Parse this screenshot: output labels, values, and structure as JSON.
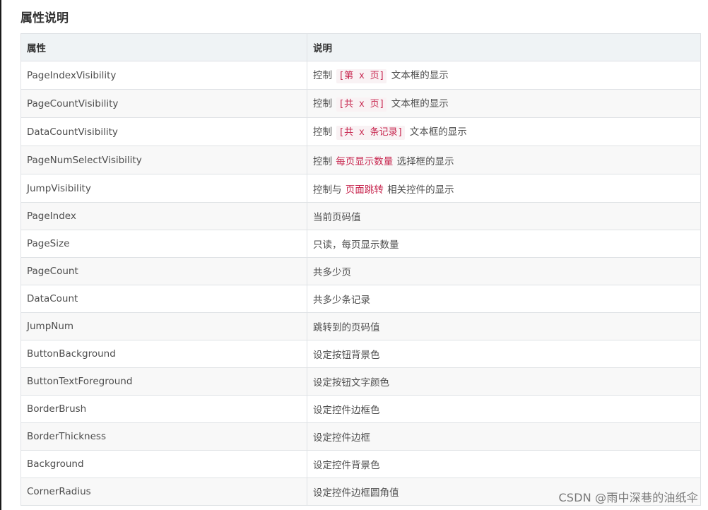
{
  "heading": "属性说明",
  "table": {
    "headers": [
      "属性",
      "说明"
    ],
    "rows": [
      {
        "property": "PageIndexVisibility",
        "pre": "控制 ",
        "code": "[第 x 页]",
        "post": " 文本框的显示",
        "style": "code"
      },
      {
        "property": "PageCountVisibility",
        "pre": "控制 ",
        "code": "[共 x 页]",
        "post": " 文本框的显示",
        "style": "code"
      },
      {
        "property": "DataCountVisibility",
        "pre": "控制 ",
        "code": "[共 x 条记录]",
        "post": " 文本框的显示",
        "style": "code"
      },
      {
        "property": "PageNumSelectVisibility",
        "pre": "控制 ",
        "code": "每页显示数量",
        "post": " 选择框的显示",
        "style": "hl"
      },
      {
        "property": "JumpVisibility",
        "pre": "控制与 ",
        "code": "页面跳转",
        "post": " 相关控件的显示",
        "style": "hl"
      },
      {
        "property": "PageIndex",
        "text": "当前页码值"
      },
      {
        "property": "PageSize",
        "text": "只读，每页显示数量"
      },
      {
        "property": "PageCount",
        "text": "共多少页"
      },
      {
        "property": "DataCount",
        "text": "共多少条记录"
      },
      {
        "property": "JumpNum",
        "text": "跳转到的页码值"
      },
      {
        "property": "ButtonBackground",
        "text": "设定按钮背景色"
      },
      {
        "property": "ButtonTextForeground",
        "text": "设定按钮文字颜色"
      },
      {
        "property": "BorderBrush",
        "text": "设定控件边框色"
      },
      {
        "property": "BorderThickness",
        "text": "设定控件边框"
      },
      {
        "property": "Background",
        "text": "设定控件背景色"
      },
      {
        "property": "CornerRadius",
        "text": "设定控件边框圆角值"
      }
    ]
  },
  "watermark": "CSDN @雨中深巷的油纸伞",
  "colors": {
    "header_bg": "#eff3f5",
    "stripe_bg": "#f8f8f8",
    "code_bg": "#f9f2f4",
    "code_fg": "#c7254e",
    "border": "#dfe2e5"
  }
}
